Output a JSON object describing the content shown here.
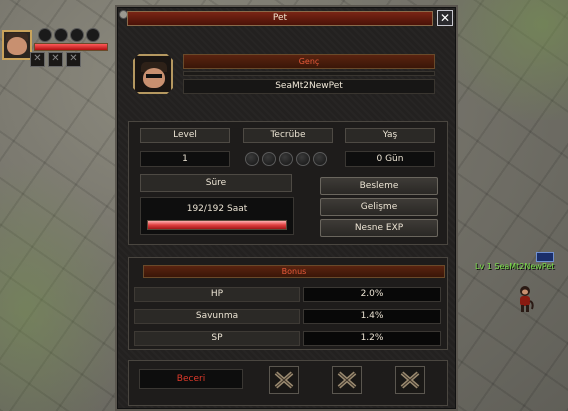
{
  "window": {
    "title": "Pet",
    "close_label": "✕"
  },
  "pet_header": {
    "type": "Genç",
    "name": "SeaMt2NewPet"
  },
  "info": {
    "level_label": "Level",
    "level_value": "1",
    "exp_label": "Tecrübe",
    "exp_slots": 5,
    "age_label": "Yaş",
    "age_value": "0 Gün",
    "duration_label": "Süre",
    "duration_value": "192/192 Saat",
    "duration_fraction": 1.0
  },
  "buttons": {
    "feed": "Besleme",
    "evolve": "Gelişme",
    "item_exp": "Nesne EXP"
  },
  "bonus": {
    "title": "Bonus",
    "rows": [
      {
        "label": "HP",
        "value": "2.0%"
      },
      {
        "label": "Savunma",
        "value": "1.4%"
      },
      {
        "label": "SP",
        "value": "1.2%"
      }
    ]
  },
  "skills": {
    "label": "Beceri",
    "slots": 3
  },
  "world": {
    "pet_nameplate": "Lv 1 SeaMt2NewPet"
  },
  "colors": {
    "title_red": "#7a2515",
    "accent_red": "#e85a3a",
    "name_green": "#7adf4a",
    "hp_red": "#e04040"
  }
}
